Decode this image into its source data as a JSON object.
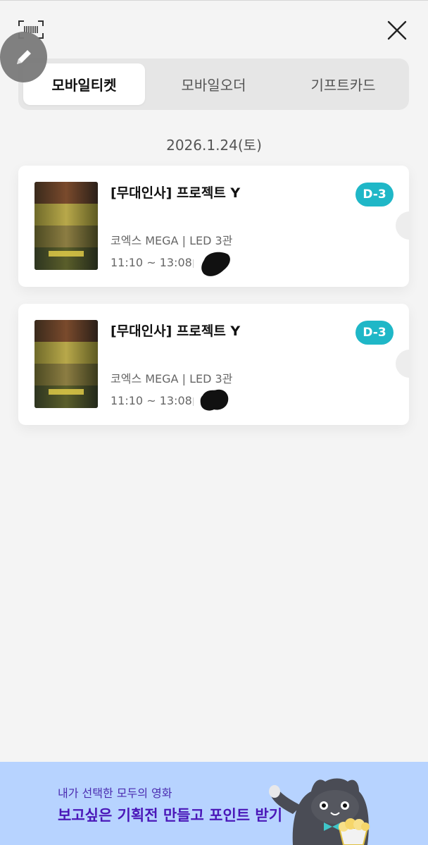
{
  "header": {
    "barcode_icon": "barcode-scan-icon",
    "close_icon": "close-icon",
    "edit_icon": "pencil-icon"
  },
  "tabs": [
    {
      "label": "모바일티켓",
      "active": true
    },
    {
      "label": "모바일오더",
      "active": false
    },
    {
      "label": "기프트카드",
      "active": false
    }
  ],
  "date": "2026.1.24(토)",
  "tickets": [
    {
      "title": "[무대인사] 프로젝트 Y",
      "dday": "D-3",
      "venue": "코엑스 MEGA | LED 3관",
      "time": "11:10 ~ 13:08"
    },
    {
      "title": "[무대인사] 프로젝트 Y",
      "dday": "D-3",
      "venue": "코엑스 MEGA | LED 3관",
      "time": "11:10 ~ 13:08"
    }
  ],
  "banner": {
    "subtitle": "내가 선택한 모두의 영화",
    "title": "보고싶은 기획전 만들고 포인트 받기"
  },
  "colors": {
    "accent": "#1fb7c7",
    "banner_bg": "#b7d3ff",
    "banner_text": "#4a17b8",
    "background": "#f4f4f4"
  }
}
